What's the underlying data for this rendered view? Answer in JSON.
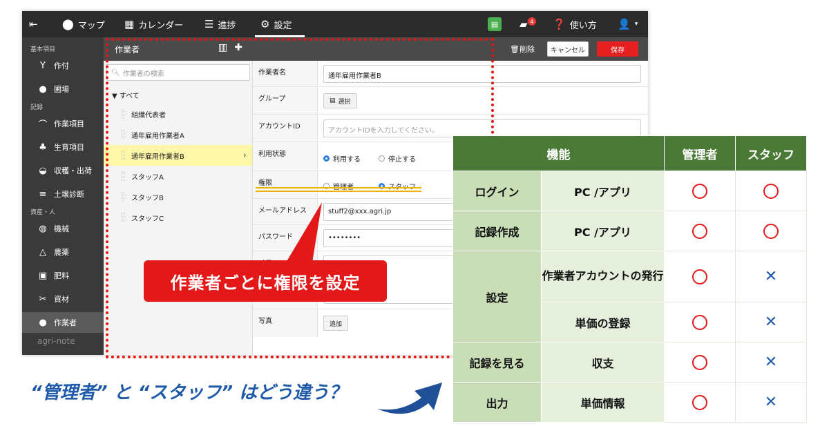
{
  "nav": {
    "map": "マップ",
    "calendar": "カレンダー",
    "progress": "進捗",
    "settings": "設定",
    "notification_count": "4",
    "help": "使い方"
  },
  "sidebar": {
    "section_basic": "基本項目",
    "crop": "作付",
    "field": "圃場",
    "section_record": "記録",
    "work_item": "作業項目",
    "growth_item": "生育項目",
    "harvest": "収穫・出荷",
    "soil": "土壌診断",
    "section_assets": "資産・人",
    "machine": "機械",
    "pesticide": "農薬",
    "fertilizer": "肥料",
    "materials": "資材",
    "workers": "作業者",
    "logo": "agri-note"
  },
  "header": {
    "title": "作業者",
    "delete": "削除",
    "cancel": "キャンセル",
    "save": "保存"
  },
  "worker_list": {
    "search_placeholder": "作業者の検索",
    "root": "▼ すべて",
    "items": [
      "組織代表者",
      "通年雇用作業者A",
      "通年雇用作業者B",
      "スタッフA",
      "スタッフB",
      "スタッフC"
    ]
  },
  "form": {
    "name_label": "作業者名",
    "name_value": "通年雇用作業者B",
    "group_label": "グループ",
    "group_button": "選択",
    "account_label": "アカウントID",
    "account_placeholder": "アカウントIDを入力してください。",
    "status_label": "利用状態",
    "status_use": "利用する",
    "status_stop": "停止する",
    "role_label": "権限",
    "role_admin": "管理者",
    "role_staff": "スタッフ",
    "email_label": "メールアドレス",
    "email_value": "stuff2@xxx.agri.jp",
    "password_label": "パスワード",
    "password_value": "••••••••",
    "memo_label": "メモ",
    "photo_label": "写真",
    "photo_button": "追加"
  },
  "callout": "作業者ごとに権限を設定",
  "caption": "“管理者” と “スタッフ” はどう違う？",
  "table": {
    "head_function": "機能",
    "head_admin": "管理者",
    "head_staff": "スタッフ",
    "rows": [
      {
        "cat": "ログイン",
        "sub": "PC /アプリ",
        "admin": "○",
        "staff": "○"
      },
      {
        "cat": "記録作成",
        "sub": "PC /アプリ",
        "admin": "○",
        "staff": "○"
      },
      {
        "cat": "設定",
        "sub": "作業者アカウントの発行",
        "admin": "○",
        "staff": "×"
      },
      {
        "cat": "設定",
        "sub": "単価の登録",
        "admin": "○",
        "staff": "×"
      },
      {
        "cat": "記録を見る",
        "sub": "収支",
        "admin": "○",
        "staff": "×"
      },
      {
        "cat": "出力",
        "sub": "単価情報",
        "admin": "○",
        "staff": "×"
      }
    ]
  },
  "colors": {
    "table_header": "#4a7a35",
    "cat_cell": "#c9ddb6",
    "sub_cell": "#e6efdc",
    "accent_red": "#e31919",
    "caption_blue": "#1f5aa8"
  }
}
